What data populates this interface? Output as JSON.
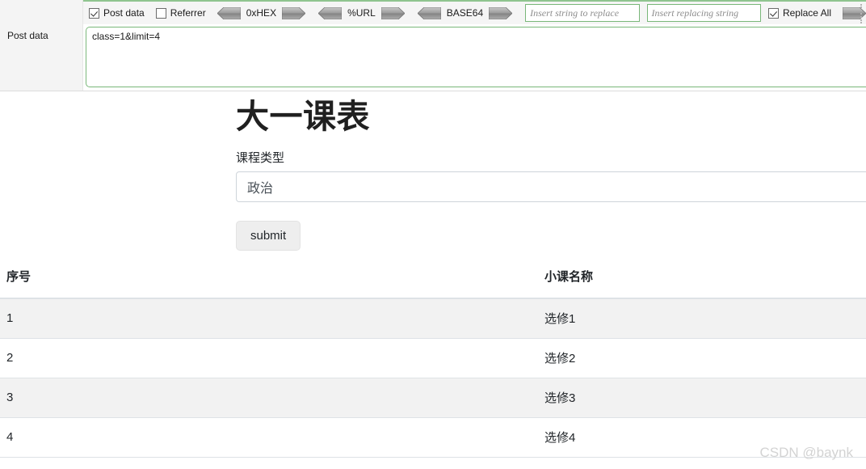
{
  "tool_panel": {
    "left_column_label": "Post data",
    "checkboxes": [
      {
        "label": "Post data",
        "checked": true
      },
      {
        "label": "Referrer",
        "checked": false
      }
    ],
    "converters": [
      {
        "label": "0xHEX",
        "left_icon": "chevron-left-button",
        "right_icon": "chevron-right-button"
      },
      {
        "label": "%URL",
        "left_icon": "chevron-left-button",
        "right_icon": "chevron-right-button"
      },
      {
        "label": "BASE64",
        "left_icon": "chevron-left-button",
        "right_icon": "chevron-right-button"
      }
    ],
    "replace_from": {
      "value": "",
      "placeholder": "Insert string to replace"
    },
    "replace_to": {
      "value": "",
      "placeholder": "Insert replacing string"
    },
    "replace_all": {
      "label": "Replace All",
      "checked": true
    },
    "replace_apply_icon": "chevron-right-button",
    "grip_icon": "toolbar-grip-icon",
    "post_data_value": "class=1&limit=4",
    "border_color": "#79b779"
  },
  "page": {
    "title": "大一课表",
    "form": {
      "field_label": "课程类型",
      "input_value": "政治",
      "input_placeholder": "",
      "submit_label": "submit"
    },
    "table": {
      "columns": [
        "序号",
        "小课名称"
      ],
      "rows": [
        {
          "index": "1",
          "name": "选修1"
        },
        {
          "index": "2",
          "name": "选修2"
        },
        {
          "index": "3",
          "name": "选修3"
        },
        {
          "index": "4",
          "name": "选修4"
        }
      ]
    }
  },
  "watermark": "CSDN @baynk"
}
